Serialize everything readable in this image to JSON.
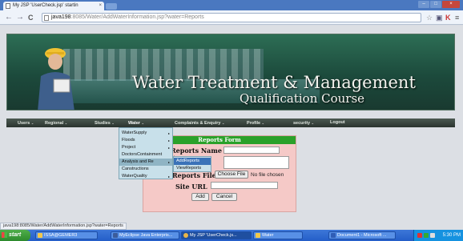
{
  "browser": {
    "tab_title": "My JSP 'UserCheck.jsp' startin",
    "tab_close": "×",
    "nav_back": "←",
    "nav_forward": "→",
    "nav_reload": "C",
    "url_host": "java198",
    "url_path": ":8085/Water/AddWaterInformation.jsp?water=Reports",
    "window_buttons": [
      "–",
      "□",
      "×"
    ]
  },
  "header": {
    "title_line1": "Water Treatment & Management",
    "title_line2": "Qualification Course"
  },
  "menu": {
    "items": [
      "Users",
      "Regional",
      "Studies",
      "Water",
      "Complaints & Enquiry",
      "Profile",
      "security",
      "Logout"
    ],
    "active": "Water",
    "arrow": "⌄"
  },
  "water_menu": {
    "items": [
      "WaterSupply",
      "Floods",
      "Project",
      "DoctorsContainment",
      "Analysis and Re",
      "Canstructions",
      "WaterQuality"
    ],
    "highlighted": "Analysis and Re",
    "sub_arrow": "▸"
  },
  "reports_submenu": {
    "items": [
      "AddReports",
      "ViewReports"
    ],
    "highlighted": "AddReports"
  },
  "form": {
    "title": "Reports Form",
    "name_label": "Reports Name :",
    "desc_label": "ents",
    "file_label": "Reports File",
    "choose_file": "Choose File",
    "no_file": "No file chosen",
    "url_label": "Site URL",
    "add": "Add",
    "cancel": "Cancel"
  },
  "status_url": "java198:8085/Water/AddWaterInformation.jsp?water=Reports",
  "taskbar": {
    "start": "start",
    "tasks": [
      "ISSA@GEMER3",
      "MyEclipse Java Enterpris...",
      "My JSP 'UserCheck.js...",
      "Water",
      "Document1 - Microsoft ..."
    ],
    "active": "My JSP 'UserCheck.js...",
    "clock": "5:30 PM"
  }
}
